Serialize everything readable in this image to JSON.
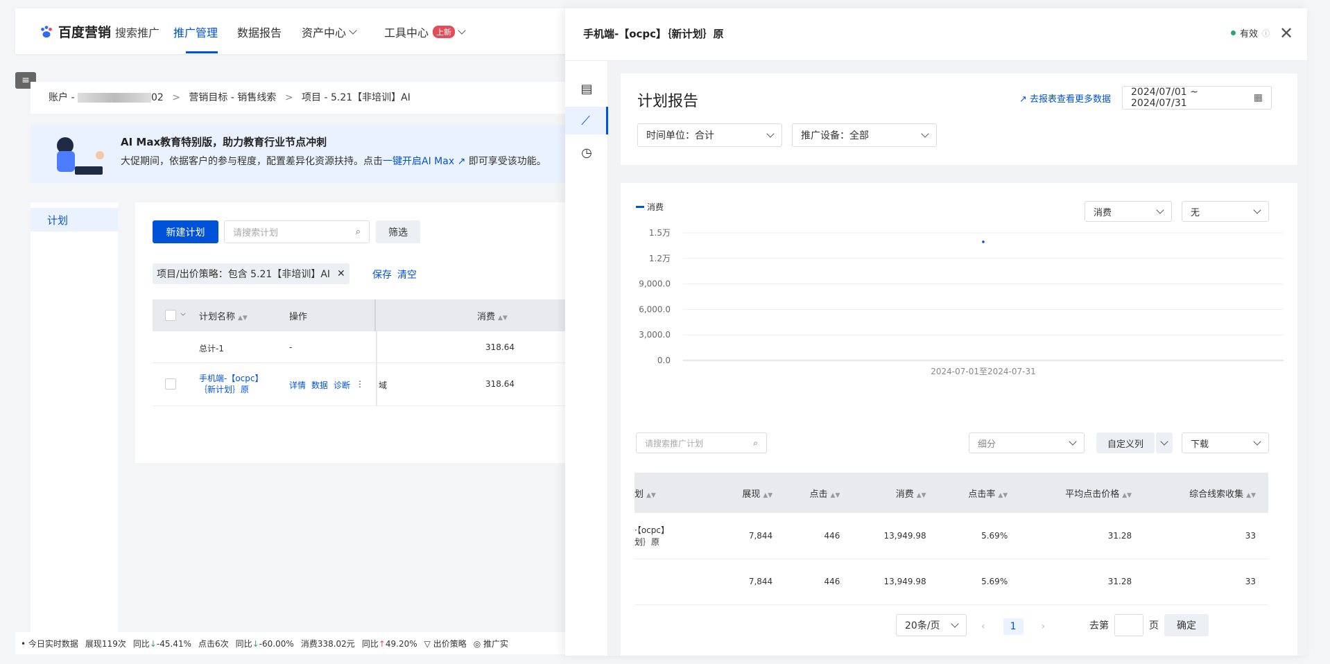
{
  "app": {
    "logo_text": "百度营销",
    "logo_sub": "搜索推广"
  },
  "nav": {
    "items": [
      "推广管理",
      "数据报告",
      "资产中心",
      "工具中心"
    ],
    "new_badge": "上新"
  },
  "breadcrumb": {
    "account": "账户 - ",
    "account_suffix": "02",
    "sep": ">",
    "goal": "营销目标 - 销售线索",
    "project": "项目 - 5.21【非培训】AI"
  },
  "banner": {
    "title": "AI Max教育特别版，助力教育行业节点冲刺",
    "text": "大促期间，依据客户的参与程度，配置差异化资源扶持。点击",
    "link": "一键开启AI Max",
    "tail": "即可享受该功能。"
  },
  "left_nav": {
    "item": "计划"
  },
  "toolbar": {
    "new_button": "新建计划",
    "search_placeholder": "请搜索计划",
    "filter_button": "筛选"
  },
  "filter_tag": {
    "text": "项目/出价策略：包含  5.21【非培训】AI",
    "save": "保存",
    "clear": "清空"
  },
  "plan_table": {
    "headers": {
      "name": "计划名称",
      "op": "操作",
      "cost": "消费"
    },
    "total": {
      "name": "总计-1",
      "op": "-",
      "cost": "318.64"
    },
    "row": {
      "name": "手机端-【ocpc】｛新计划｝原",
      "actions": [
        "详情",
        "数据",
        "诊断"
      ],
      "region": "域",
      "cost": "318.64"
    }
  },
  "bottombar": {
    "realtime": "今日实时数据",
    "impr": "展现119次",
    "impr_cmp_label": "同比",
    "impr_cmp": "-45.41%",
    "click": "点击6次",
    "click_cmp_label": "同比",
    "click_cmp": "-60.00%",
    "cost": "消费338.02元",
    "cost_cmp_label": "同比",
    "cost_cmp": "49.20%",
    "bid": "出价策略",
    "promo": "推广实"
  },
  "drawer": {
    "title": "手机端-【ocpc】｛新计划｝原",
    "status": "有效",
    "report_title": "计划报告",
    "more_link": "去报表查看更多数据",
    "date_range": "2024/07/01 ~ 2024/07/31",
    "time_unit": "时间单位：合计",
    "device": "推广设备：全部",
    "metric_select": "消费",
    "compare_select": "无",
    "table_search_placeholder": "请搜索推广计划",
    "breakdown_select": "细分",
    "custom_cols": "自定义列",
    "download": "下载",
    "table": {
      "headers": [
        "划",
        "展现",
        "点击",
        "消费",
        "点击率",
        "平均点击价格",
        "综合线索收集"
      ],
      "rows": [
        [
          "·【ocpc】\n划｝原",
          "7,844",
          "446",
          "13,949.98",
          "5.69%",
          "31.28",
          "33"
        ],
        [
          "",
          "7,844",
          "446",
          "13,949.98",
          "5.69%",
          "31.28",
          "33"
        ]
      ]
    },
    "pager": {
      "page_size": "20条/页",
      "current": "1",
      "goto": "去第",
      "page_unit": "页",
      "confirm": "确定"
    }
  },
  "chart_data": {
    "type": "line",
    "categories": [
      "2024-07-01至2024-07-31"
    ],
    "series": [
      {
        "name": "消费",
        "values": [
          13949.98
        ]
      }
    ],
    "yticks": [
      "0.0",
      "3,000.0",
      "6,000.0",
      "9,000.0",
      "1.2万",
      "1.5万"
    ],
    "ylim": [
      0,
      15000
    ],
    "grid": true,
    "legend": "top-left",
    "color": "#0052d9"
  }
}
